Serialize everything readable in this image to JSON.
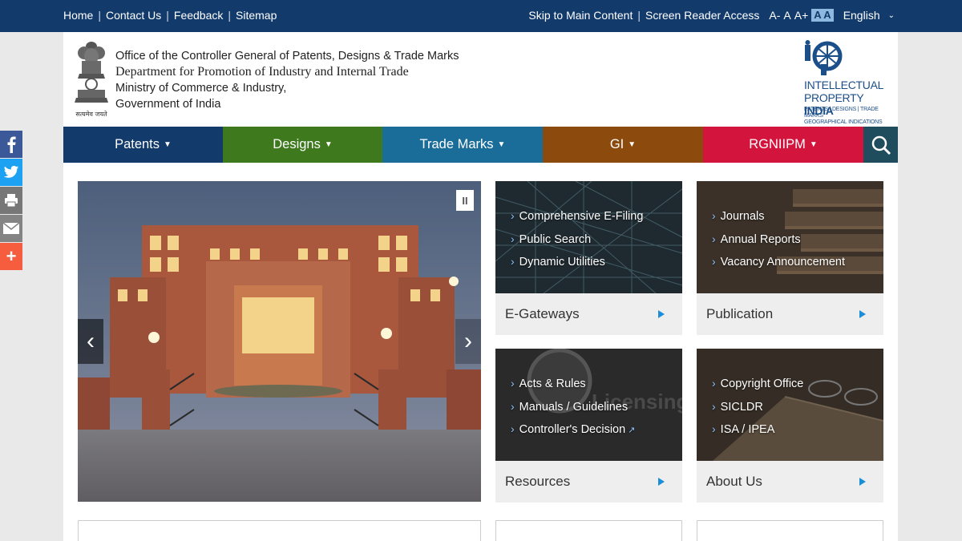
{
  "topbar": {
    "links": [
      "Home",
      "Contact Us",
      "Feedback",
      "Sitemap"
    ],
    "skip": "Skip to Main Content",
    "screen_reader": "Screen Reader Access",
    "font_minus": "A-",
    "font_normal": "A",
    "font_plus": "A+",
    "contrast": "A A",
    "language": "English"
  },
  "header": {
    "org_line1": "Office of the Controller General of Patents, Designs & Trade Marks",
    "org_line2": "Department for Promotion of Industry and Internal Trade",
    "org_line3": "Ministry of Commerce & Industry,",
    "org_line4": "Government of India",
    "emblem_caption": "सत्यमेव जयते",
    "logo_line1": "INTELLECTUAL",
    "logo_line2a": "PROPERTY ",
    "logo_line2b": "INDIA",
    "logo_line3": "PATENTS | DESIGNS | TRADE MARKS",
    "logo_line4": "GEOGRAPHICAL INDICATIONS"
  },
  "nav": {
    "items": [
      {
        "label": "Patents",
        "color": "#123a6b"
      },
      {
        "label": "Designs",
        "color": "#3e7a1d"
      },
      {
        "label": "Trade Marks",
        "color": "#1a6c99"
      },
      {
        "label": "GI",
        "color": "#8c4a0d"
      },
      {
        "label": "RGNIIPM",
        "color": "#d3143d"
      }
    ]
  },
  "slider": {
    "pause_label": "II",
    "prev": "‹",
    "next": "›"
  },
  "tiles": {
    "egateways": {
      "title": "E-Gateways",
      "links": [
        "Comprehensive E-Filing",
        "Public Search",
        "Dynamic Utilities"
      ]
    },
    "publication": {
      "title": "Publication",
      "links": [
        "Journals",
        "Annual Reports",
        "Vacancy Announcement"
      ]
    },
    "resources": {
      "title": "Resources",
      "links": [
        "Acts & Rules",
        "Manuals / Guidelines",
        "Controller's Decision"
      ],
      "bg_text": "Licensing"
    },
    "about": {
      "title": "About Us",
      "links": [
        "Copyright Office",
        "SICLDR",
        "ISA / IPEA"
      ]
    }
  },
  "social": [
    "facebook-icon",
    "twitter-icon",
    "print-icon",
    "email-icon",
    "share-more-icon"
  ]
}
